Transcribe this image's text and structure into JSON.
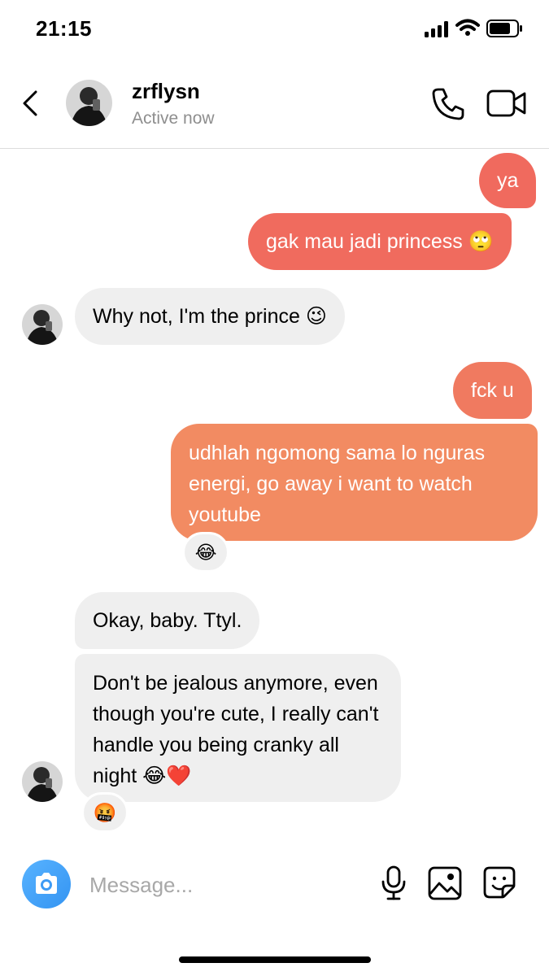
{
  "status_bar": {
    "time": "21:15"
  },
  "header": {
    "name": "zrflysn",
    "status": "Active now"
  },
  "messages": [
    {
      "from": "me",
      "text": "ya"
    },
    {
      "from": "me",
      "text": "gak mau jadi princess 🙄"
    },
    {
      "from": "them",
      "text": "Why not, I'm the prince 😉"
    },
    {
      "from": "me",
      "text": "fck u"
    },
    {
      "from": "me",
      "text": "udhlah ngomong sama lo nguras energi, go away i want to watch youtube",
      "reaction": "😂"
    },
    {
      "from": "them",
      "text": "Okay, baby. Ttyl."
    },
    {
      "from": "them",
      "text": "Don't be jealous anymore, even though you're cute, I really can't handle you being cranky all night 😂❤️",
      "reaction": "🤬"
    }
  ],
  "composer": {
    "placeholder": "Message..."
  },
  "colors": {
    "outgoing_top": "#f06a5e",
    "outgoing_bottom": "#f28b62",
    "incoming": "#efefef",
    "camera_button": "#3d9bf5"
  },
  "icons": [
    "back-chevron-icon",
    "phone-icon",
    "video-camera-icon",
    "camera-icon",
    "microphone-icon",
    "gallery-icon",
    "sticker-icon"
  ]
}
